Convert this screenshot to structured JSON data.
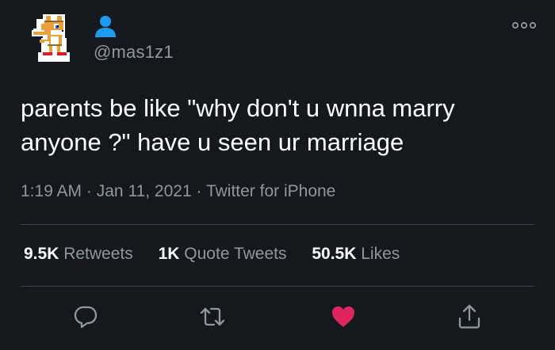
{
  "user": {
    "handle": "@mas1z1"
  },
  "tweet": {
    "text_line1": "parents be like \"why don't u wnna marry",
    "text_line2": "anyone ?\" have u seen ur marriage",
    "time": "1:19 AM",
    "date": "Jan 11, 2021",
    "source": "Twitter for iPhone",
    "separator": "·"
  },
  "stats": {
    "retweets": {
      "value": "9.5K",
      "label": "Retweets"
    },
    "quote_tweets": {
      "value": "1K",
      "label": "Quote Tweets"
    },
    "likes": {
      "value": "50.5K",
      "label": "Likes"
    }
  },
  "actions": {
    "reply": "reply-icon",
    "retweet": "retweet-icon",
    "like": "heart-icon",
    "share": "share-icon"
  },
  "colors": {
    "background": "#15181c",
    "accent": "#1d9bf0",
    "like": "#e0245e",
    "muted_text": "#8b98a5",
    "divider": "#38444d"
  }
}
